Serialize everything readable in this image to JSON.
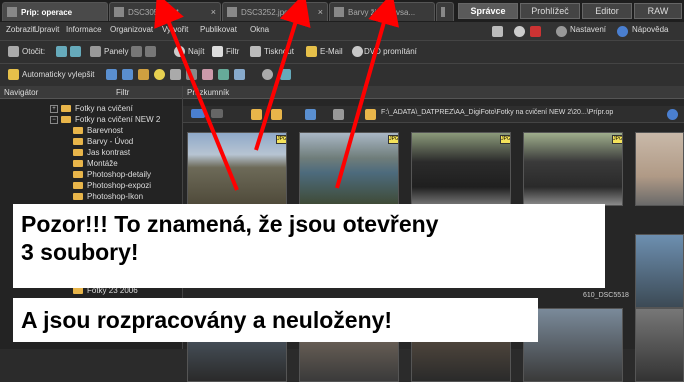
{
  "tabs": [
    {
      "label": "Prip: operace",
      "active": true
    },
    {
      "label": "DSC3051.jpg*",
      "active": false
    },
    {
      "label": "DSC3252.jpg*",
      "active": false
    },
    {
      "label": "Barvy života .vsa...",
      "active": false
    }
  ],
  "modes": [
    "Správce",
    "Prohlížeč",
    "Editor",
    "RAW"
  ],
  "menu": [
    "Zobrazit",
    "Upravit",
    "Informace",
    "Organizovat",
    "Vytvořit",
    "Publikovat",
    "Okna"
  ],
  "menu_right": {
    "settings": "Nastavení",
    "help": "Nápověda"
  },
  "toolbar1": {
    "rotate": "Otočit:",
    "panels": "Panely",
    "find": "Najít",
    "filter": "Filtr",
    "print": "Tisknout",
    "email": "E-Mail",
    "dvd": "DVD promítání"
  },
  "toolbar2": {
    "auto": "Automaticky vylepšit"
  },
  "navigator": {
    "title": "Navigátor",
    "filter": "Filtr",
    "tree": [
      "Fotky na cvičení",
      "Fotky na cvičení NEW 2",
      "Barevnost",
      "Barvy - Úvod",
      "Jas kontrast",
      "Montáže",
      "Photoshop-detaily",
      "Photoshop-expozi",
      "Photoshop-Ikon"
    ],
    "tree_bottom": "Fotky 23 2006"
  },
  "browser": {
    "title": "Průzkumník",
    "path": "F:\\_ADATA\\_DATPREZ\\AA_DigiFoto\\Fotky na cvičení NEW 2\\20...\\Prípr.op",
    "thumb_caption": "610_DSC5518",
    "badge": "JPG"
  },
  "callouts": {
    "line1": "Pozor!!! To znamená, že jsou otevřeny",
    "line2": "3 soubory!",
    "line3": "A jsou rozpracovány a neuloženy!"
  },
  "colors": {
    "arrow": "#ff0000",
    "callout_bg": "#ffffff",
    "folder": "#e8b54a"
  }
}
